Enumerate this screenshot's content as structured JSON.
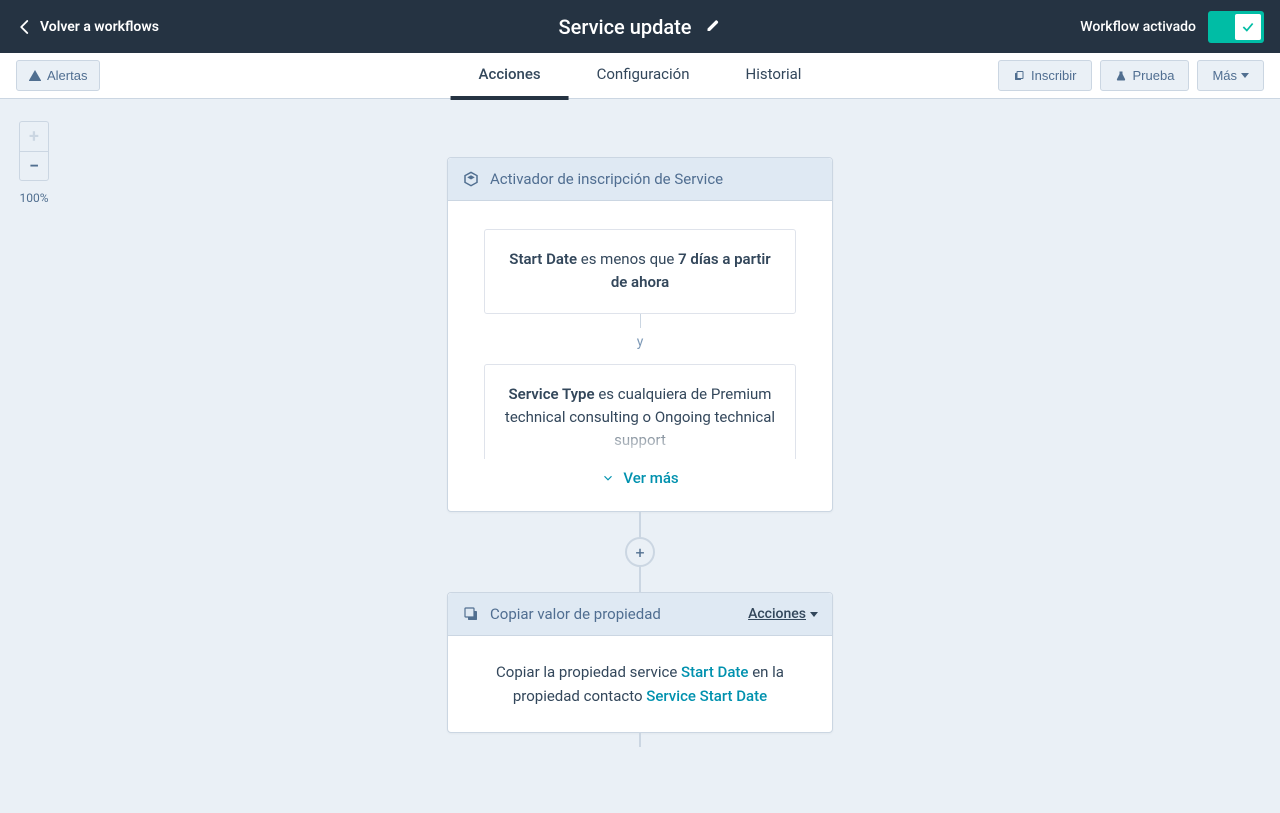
{
  "header": {
    "back_label": "Volver a workflows",
    "title": "Service update",
    "status_label": "Workflow activado"
  },
  "subheader": {
    "alerts_label": "Alertas",
    "tabs": {
      "actions": "Acciones",
      "config": "Configuración",
      "history": "Historial"
    },
    "enroll_label": "Inscribir",
    "test_label": "Prueba",
    "more_label": "Más"
  },
  "zoom": {
    "level": "100%"
  },
  "trigger": {
    "header_title": "Activador de inscripción de Service",
    "criteria1": {
      "prop": "Start Date",
      "op_pre": "es menos que",
      "val": "7 días a partir de ahora"
    },
    "and_label": "y",
    "criteria2": {
      "prop": "Service Type",
      "op_pre": "es cualquiera de",
      "val1": "Premium technical consulting",
      "suffix": "o",
      "val2": "Ongoing technical support"
    },
    "see_more": "Ver más"
  },
  "copy_card": {
    "header_title": "Copiar valor de propiedad",
    "actions_label": "Acciones",
    "text_pre": "Copiar la propiedad service ",
    "prop1": "Start Date",
    "text_mid": " en la propiedad contacto ",
    "prop2": "Service Start Date"
  }
}
